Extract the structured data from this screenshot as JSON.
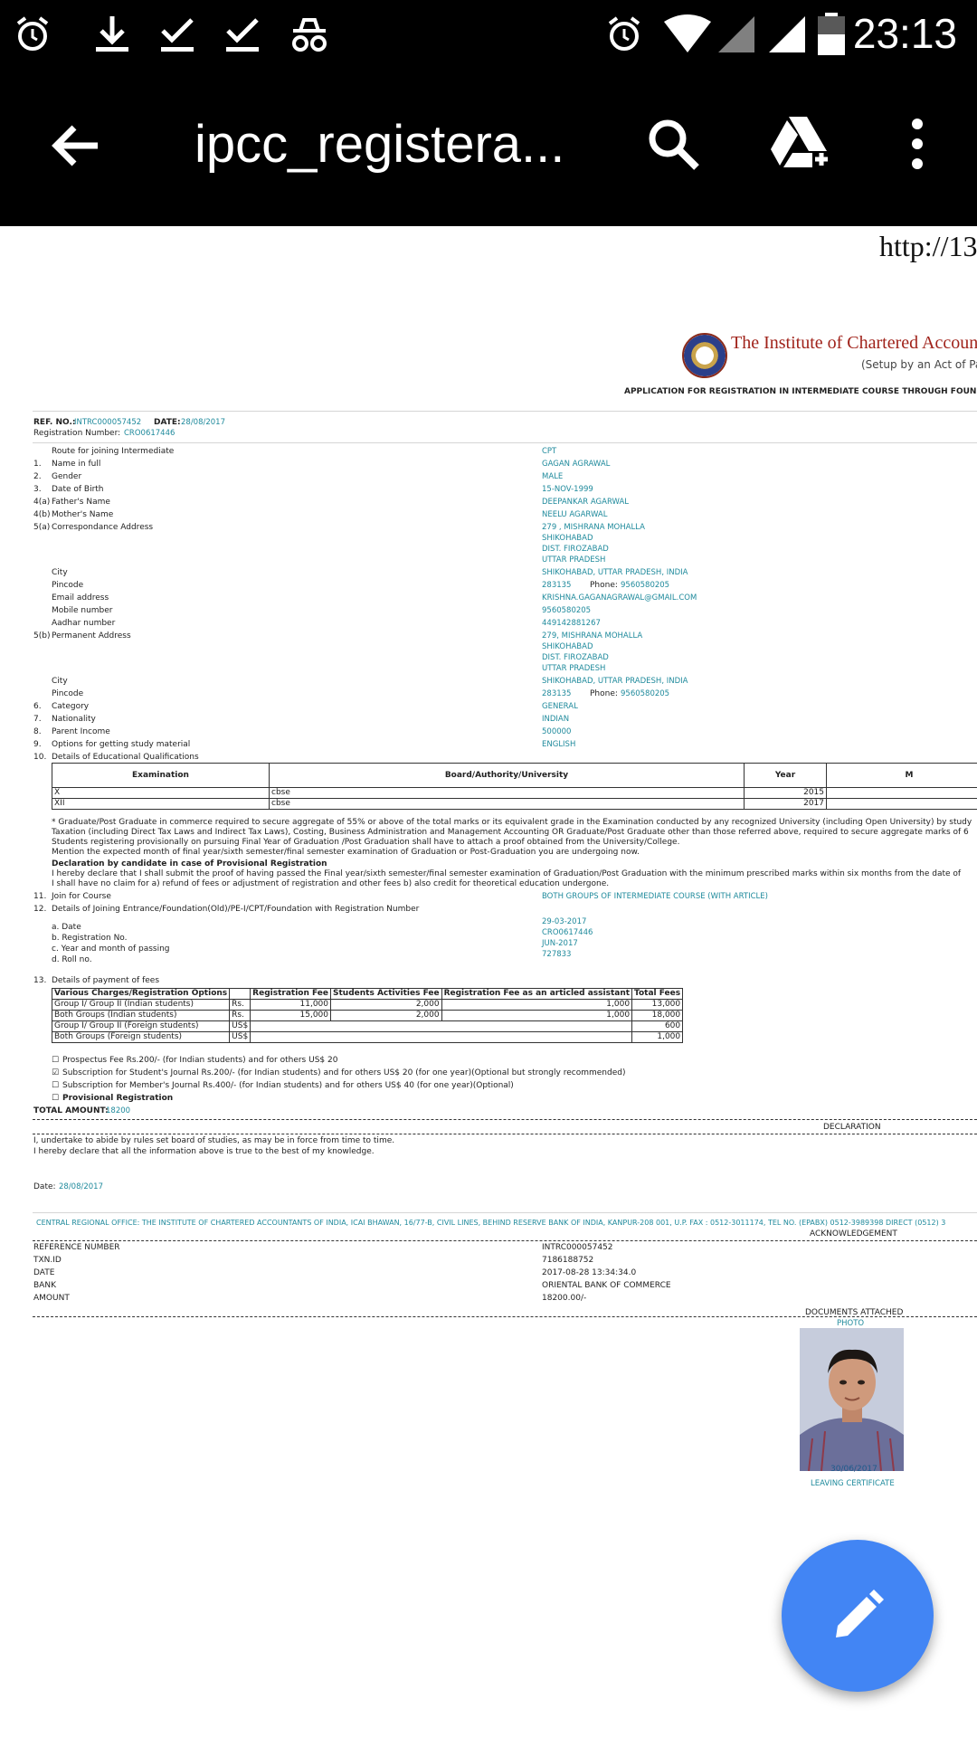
{
  "status_bar": {
    "time": "23:13"
  },
  "app_bar": {
    "title": "ipcc_registera..."
  },
  "document": {
    "url_fragment": "http://13",
    "institute": "The Institute of Chartered Accountants of",
    "setup": "(Setup by an Act of Parli",
    "app_title": "APPLICATION FOR REGISTRATION IN INTERMEDIATE COURSE THROUGH FOUNDATION\\CP",
    "ref_label": "REF. NO.:",
    "ref_value": "INTRC000057452",
    "date_label": "DATE:",
    "date_value": "28/08/2017",
    "reg_label": "Registration Number:",
    "reg_value": "CRO0617446",
    "fields": [
      {
        "num": "",
        "label": "Route for joining Intermediate",
        "value": "CPT"
      },
      {
        "num": "1.",
        "label": "Name in full",
        "value": "GAGAN AGRAWAL"
      },
      {
        "num": "2.",
        "label": "Gender",
        "value": "MALE"
      },
      {
        "num": "3.",
        "label": "Date of Birth",
        "value": "15-NOV-1999"
      },
      {
        "num": "4(a)",
        "label": "Father's Name",
        "value": "DEEPANKAR AGARWAL"
      },
      {
        "num": "4(b)",
        "label": "Mother's Name",
        "value": "NEELU AGARWAL"
      }
    ],
    "corr_addr": {
      "num": "5(a)",
      "label": "Correspondance Address",
      "lines": [
        "279 , MISHRANA MOHALLA",
        "SHIKOHABAD",
        "DIST. FIROZABAD",
        "UTTAR PRADESH"
      ]
    },
    "corr_city": {
      "label": "City",
      "value": "SHIKOHABAD, UTTAR PRADESH, INDIA"
    },
    "corr_pin": {
      "label": "Pincode",
      "value": "283135",
      "phone_label": "Phone:",
      "phone": "9560580205"
    },
    "email": {
      "label": "Email address",
      "value": "KRISHNA.GAGANAGRAWAL@GMAIL.COM"
    },
    "mobile": {
      "label": "Mobile number",
      "value": "9560580205"
    },
    "aadhar": {
      "label": "Aadhar number",
      "value": "449142881267"
    },
    "perm_addr": {
      "num": "5(b)",
      "label": "Permanent Address",
      "lines": [
        "279, MISHRANA MOHALLA",
        "SHIKOHABAD",
        "DIST. FIROZABAD",
        "UTTAR PRADESH"
      ]
    },
    "perm_city": {
      "label": "City",
      "value": "SHIKOHABAD, UTTAR PRADESH, INDIA"
    },
    "perm_pin": {
      "label": "Pincode",
      "value": "283135",
      "phone_label": "Phone:",
      "phone": "9560580205"
    },
    "fields2": [
      {
        "num": "6.",
        "label": "Category",
        "value": "GENERAL"
      },
      {
        "num": "7.",
        "label": "Nationality",
        "value": "INDIAN"
      },
      {
        "num": "8.",
        "label": "Parent Income",
        "value": "500000"
      },
      {
        "num": "9.",
        "label": "Options for getting study material",
        "value": "ENGLISH"
      },
      {
        "num": "10.",
        "label": "Details of Educational Qualifications",
        "value": ""
      }
    ],
    "edu_table": {
      "headers": [
        "Examination",
        "Board/Authority/University",
        "Year",
        "M"
      ],
      "rows": [
        {
          "exam": "X",
          "board": "cbse",
          "year": "2015"
        },
        {
          "exam": "XII",
          "board": "cbse",
          "year": "2017"
        }
      ]
    },
    "notes": [
      "* Graduate/Post Graduate in commerce required to secure aggregate of 55% or above of the total marks or its equivalent grade in the Examination conducted by any recognized University (including Open University) by study",
      "Taxation (including Direct Tax Laws and Indirect Tax Laws), Costing, Business Administration and Management Accounting OR Graduate/Post Graduate other than those referred above, required to secure aggregate marks of 6",
      "Students registering provisionally on pursuing Final Year of Graduation /Post Graduation shall have to attach a proof obtained from the University/College.",
      "Mention the expected month of final year/sixth semester/final semester examination of Graduation or Post-Graduation you are undergoing now."
    ],
    "decl_heading": "Declaration by candidate in case of Provisional Registration",
    "decl_lines": [
      "I hereby declare that I shall submit the proof of having passed the Final year/sixth semester/final semester examination of Graduation/Post Graduation with the minimum prescribed marks within six months from the date of",
      "I shall have no claim for a) refund of fees or adjustment of registration and other fees b) also credit for theoretical education undergone."
    ],
    "join_course": {
      "num": "11.",
      "label": "Join for Course",
      "value": "BOTH GROUPS OF INTERMEDIATE COURSE (WITH ARTICLE)"
    },
    "entrance": {
      "num": "12.",
      "label": "Details of Joining Entrance/Foundation(Old)/PE-I/CPT/Foundation with Registration Number"
    },
    "entrance_items": [
      {
        "label": "a. Date",
        "value": "29-03-2017"
      },
      {
        "label": "b. Registration No.",
        "value": "CRO0617446"
      },
      {
        "label": "c. Year and month of passing",
        "value": "JUN-2017"
      },
      {
        "label": "d. Roll no.",
        "value": "727833"
      }
    ],
    "fees_label": {
      "num": "13.",
      "label": "Details of payment of fees"
    },
    "fee_table": {
      "headers": [
        "Various Charges/Registration Options",
        "",
        "Registration Fee",
        "Students Activities Fee",
        "Registration Fee as an articled assistant",
        "Total Fees"
      ],
      "rows": [
        {
          "option": "Group I/ Group II (Indian students)",
          "cur": "Rs.",
          "reg": "11,000",
          "act": "2,000",
          "art": "1,000",
          "total": "13,000"
        },
        {
          "option": "Both Groups (Indian students)",
          "cur": "Rs.",
          "reg": "15,000",
          "act": "2,000",
          "art": "1,000",
          "total": "18,000"
        },
        {
          "option": "Group I/ Group II (Foreign students)",
          "cur": "US$",
          "total": "600"
        },
        {
          "option": "Both Groups (Foreign students)",
          "cur": "US$",
          "total": "1,000"
        }
      ]
    },
    "checks": [
      {
        "mark": "☐",
        "text": "Prospectus Fee Rs.200/- (for Indian students) and for others US$ 20"
      },
      {
        "mark": "☑",
        "text": "Subscription for Student's Journal Rs.200/- (for Indian students) and for others US$ 20 (for one year)(Optional but strongly recommended)"
      },
      {
        "mark": "☐",
        "text": "Subscription for Member's Journal Rs.400/- (for Indian students) and for others US$ 40 (for one year)(Optional)"
      },
      {
        "mark": "☐",
        "text": "Provisional Registration"
      }
    ],
    "total_label": "TOTAL AMOUNT:",
    "total_value": "18200",
    "declaration_title": "DECLARATION",
    "undertake": "I, undertake to abide by rules set board of studies, as may be in force from time to time.",
    "hereby": "I hereby declare that all the information above is true to the best of my knowledge.",
    "sign_date_label": "Date:",
    "sign_date_value": "28/08/2017",
    "regional_office": "CENTRAL REGIONAL OFFICE: THE INSTITUTE OF CHARTERED ACCOUNTANTS OF INDIA, ICAI BHAWAN, 16/77-B, CIVIL LINES, BEHIND RESERVE BANK OF INDIA, KANPUR-208 001, U.P. FAX : 0512-3011174, TEL NO. (EPABX) 0512-3989398 DIRECT (0512) 3",
    "ack_title": "ACKNOWLEDGEMENT",
    "ack_rows": [
      {
        "label": "REFERENCE NUMBER",
        "value": "INTRC000057452"
      },
      {
        "label": "TXN.ID",
        "value": "7186188752"
      },
      {
        "label": "DATE",
        "value": "2017-08-28 13:34:34.0"
      },
      {
        "label": "BANK",
        "value": "ORIENTAL BANK OF COMMERCE"
      },
      {
        "label": "AMOUNT",
        "value": "18200.00/-"
      }
    ],
    "docs_title": "DOCUMENTS ATTACHED",
    "photo_label": "PHOTO",
    "photo_date": "30/06/2017",
    "leaving_label": "LEAVING CERTIFICATE"
  },
  "colors": {
    "value_teal": "#1f8a9c",
    "fab_blue": "#4285f4",
    "inst_red": "#a0231b"
  }
}
